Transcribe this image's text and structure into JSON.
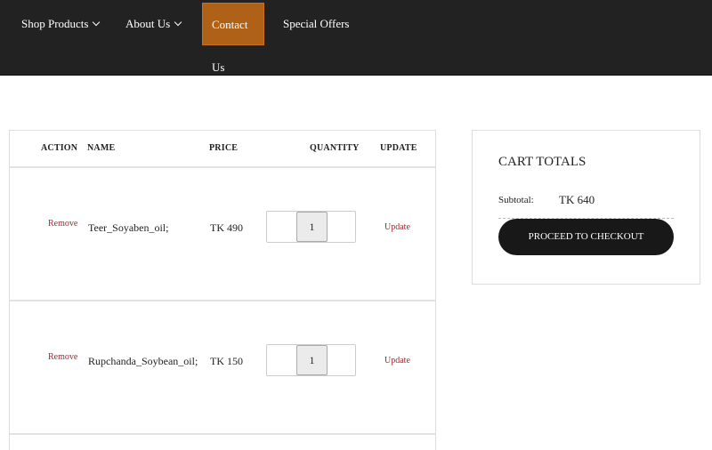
{
  "nav": {
    "items": [
      {
        "label": "Shop Products",
        "dropdown": true
      },
      {
        "label": "About Us",
        "dropdown": true
      },
      {
        "label": "Contact Us",
        "active": true
      },
      {
        "label": "Special Offers"
      }
    ],
    "active_color": "#b06118"
  },
  "table": {
    "headers": {
      "action": "ACTION",
      "name": "NAME",
      "price": "PRICE",
      "quantity": "QUANTITY",
      "update": "UPDATE"
    },
    "rows": [
      {
        "action": "Remove",
        "name": "Teer_Soyaben_oil;",
        "price": "TK 490",
        "quantity": "1",
        "update": "Update"
      },
      {
        "action": "Remove",
        "name": "Rupchanda_Soybean_oil;",
        "price": "TK 150",
        "quantity": "1",
        "update": "Update"
      }
    ]
  },
  "cart": {
    "title": "CART TOTALS",
    "subtotal_label": "Subtotal:",
    "subtotal_value": "TK 640",
    "checkout_label": "PROCEED TO CHECKOUT"
  }
}
